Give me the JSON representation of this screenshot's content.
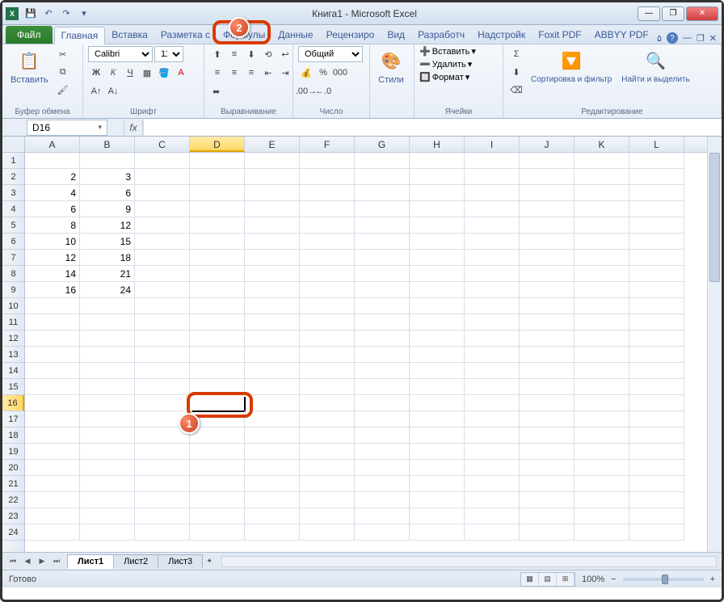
{
  "title": "Книга1 - Microsoft Excel",
  "qat": {
    "save": "💾",
    "undo": "↶",
    "redo": "↷"
  },
  "tabs": {
    "file": "Файл",
    "home": "Главная",
    "insert": "Вставка",
    "layout": "Разметка с",
    "formulas": "Формулы",
    "data": "Данные",
    "review": "Рецензиро",
    "view": "Вид",
    "developer": "Разработч",
    "addins": "Надстройк",
    "foxit": "Foxit PDF",
    "abbyy": "ABBYY PDF"
  },
  "ribbon": {
    "clipboard": {
      "label": "Буфер обмена",
      "paste": "Вставить"
    },
    "font": {
      "label": "Шрифт",
      "name": "Calibri",
      "size": "11"
    },
    "alignment": {
      "label": "Выравнивание"
    },
    "number": {
      "label": "Число",
      "format": "Общий"
    },
    "styles": {
      "label": "Стили",
      "btn": "Стили"
    },
    "cells": {
      "label": "Ячейки",
      "insert": "Вставить",
      "delete": "Удалить",
      "format": "Формат"
    },
    "editing": {
      "label": "Редактирование",
      "sort": "Сортировка и фильтр",
      "find": "Найти и выделить"
    }
  },
  "namebox": "D16",
  "fx": "fx",
  "columns": [
    "A",
    "B",
    "C",
    "D",
    "E",
    "F",
    "G",
    "H",
    "I",
    "J",
    "K",
    "L"
  ],
  "selected_col": "D",
  "selected_row": 16,
  "row_count": 24,
  "cell_data": {
    "2": {
      "A": "2",
      "B": "3"
    },
    "3": {
      "A": "4",
      "B": "6"
    },
    "4": {
      "A": "6",
      "B": "9"
    },
    "5": {
      "A": "8",
      "B": "12"
    },
    "6": {
      "A": "10",
      "B": "15"
    },
    "7": {
      "A": "12",
      "B": "18"
    },
    "8": {
      "A": "14",
      "B": "21"
    },
    "9": {
      "A": "16",
      "B": "24"
    }
  },
  "sheets": {
    "s1": "Лист1",
    "s2": "Лист2",
    "s3": "Лист3"
  },
  "status": {
    "ready": "Готово",
    "zoom": "100%"
  },
  "callouts": {
    "one": "1",
    "two": "2"
  }
}
